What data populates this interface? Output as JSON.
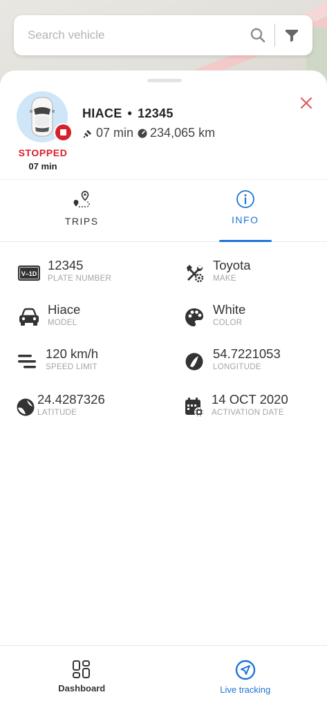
{
  "search": {
    "placeholder": "Search vehicle"
  },
  "vehicle": {
    "model": "HIACE",
    "separator": "•",
    "number": "12345",
    "duration": "07 min",
    "odometer": "234,065 km",
    "status": "STOPPED",
    "status_time": "07 min",
    "status_color": "#d6202a"
  },
  "tabs": [
    {
      "label": "TRIPS",
      "icon": "route-pin-icon",
      "active": false
    },
    {
      "label": "INFO",
      "icon": "info-icon",
      "active": true
    }
  ],
  "info": {
    "plate": {
      "value": "12345",
      "label": "PLATE NUMBER",
      "icon": "plate-icon",
      "plate_text": "V–1D"
    },
    "make": {
      "value": "Toyota",
      "label": "MAKE",
      "icon": "tools-gear-icon"
    },
    "model": {
      "value": "Hiace",
      "label": "MODEL",
      "icon": "car-icon"
    },
    "color": {
      "value": "White",
      "label": "COLOR",
      "icon": "palette-icon"
    },
    "speed_limit": {
      "value": "120 km/h",
      "label": "SPEED LIMIT",
      "icon": "speed-lines-icon"
    },
    "longitude": {
      "value": "54.7221053",
      "label": "LONGITUDE",
      "icon": "globe-longitude-icon"
    },
    "latitude": {
      "value": "24.4287326",
      "label": "LATITUDE",
      "icon": "globe-latitude-icon"
    },
    "activation": {
      "value": "14 OCT 2020",
      "label": "ACTIVATION DATE",
      "icon": "calendar-chip-icon"
    }
  },
  "nav": [
    {
      "label": "Dashboard",
      "icon": "dashboard-grid-icon",
      "active": false
    },
    {
      "label": "Live tracking",
      "icon": "navigation-arrow-icon",
      "active": true
    }
  ],
  "colors": {
    "accent": "#1a73d8",
    "danger": "#d6202a"
  }
}
